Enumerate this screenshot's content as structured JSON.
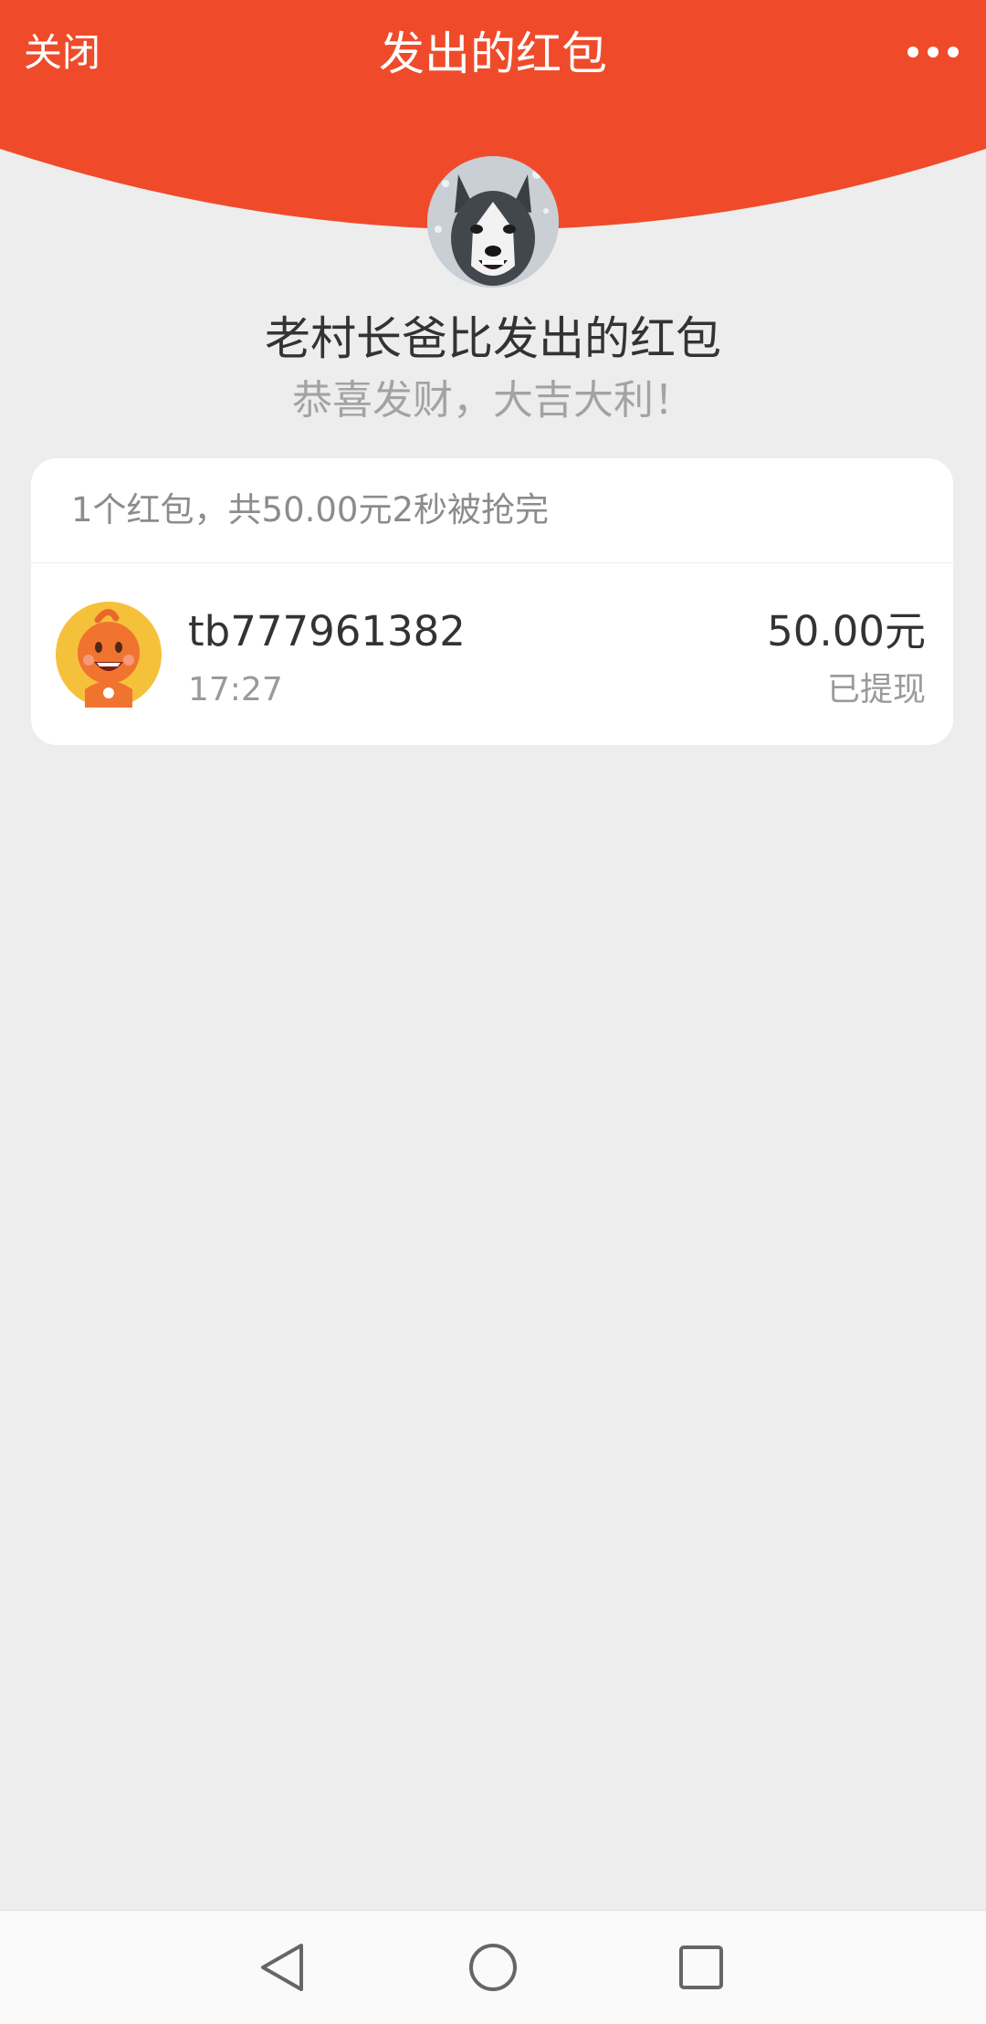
{
  "colors": {
    "header_red": "#ef4b2b",
    "page_background": "#ededed"
  },
  "header": {
    "close_label": "关闭",
    "title": "发出的红包",
    "more_icon": "more-dots-icon"
  },
  "sender": {
    "name": "老村长爸比发出的红包",
    "blessing": "恭喜发财，大吉大利！",
    "avatar": "husky-dog-avatar"
  },
  "summary": "1个红包，共50.00元2秒被抢完",
  "records": [
    {
      "user": "tb777961382",
      "time": "17:27",
      "amount": "50.00元",
      "status": "已提现",
      "avatar": "orange-cartoon-avatar"
    }
  ],
  "system_nav": {
    "back_icon": "back-triangle-icon",
    "home_icon": "home-circle-icon",
    "recents_icon": "recents-square-icon"
  }
}
